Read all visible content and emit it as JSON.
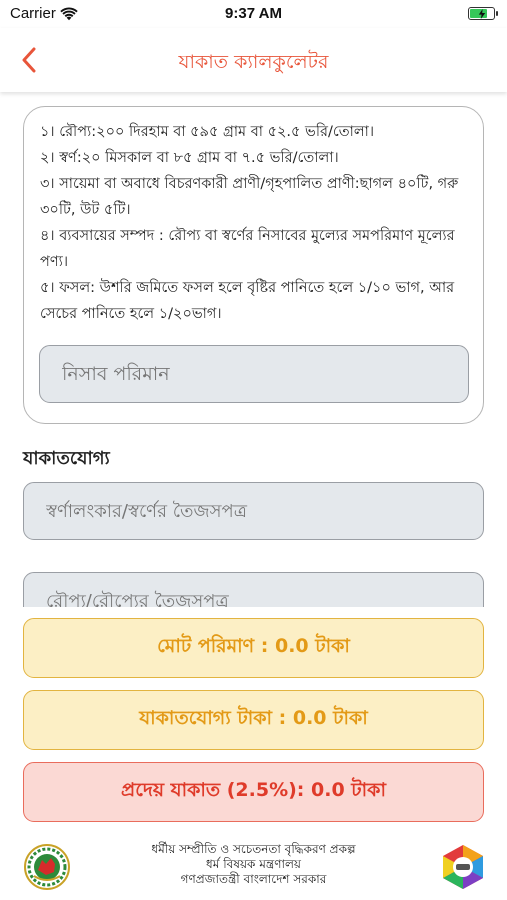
{
  "status_bar": {
    "carrier": "Carrier",
    "time": "9:37 AM",
    "battery_level": 0.75,
    "icons": [
      "wifi-icon",
      "battery-charging-icon"
    ]
  },
  "nav": {
    "title": "যাকাত ক্যালকুলেটর",
    "back_icon": "chevron-left-icon",
    "accent_color": "#e8553a"
  },
  "nisab": {
    "rules": [
      "১। রৌপ্য:২০০ দিরহাম বা ৫৯৫ গ্রাম বা ৫২.৫ ভরি/তোলা।",
      "২। স্বর্ণ:২০ মিসকাল বা ৮৫ গ্রাম বা  ৭.৫ ভরি/তোলা।",
      "৩। সায়েমা বা অবাধে বিচরণকারী প্রাণী/গৃহপালিত প্রাণী:ছাগল ৪০টি, গরু ৩০টি, উট ৫টি।",
      "৪। ব্যবসায়ের সম্পদ : রৌপ্য বা স্বর্ণের নিসাবের মুল্যের সমপরিমাণ মূল্যের পণ্য।",
      "৫। ফসল: উশরি জমিতে ফসল হলে বৃষ্টির পানিতে হলে ১/১০ ভাগ, আর সেচের পানিতে হলে ১/২০ভাগ।"
    ],
    "input_placeholder": "নিসাব পরিমান"
  },
  "zakatable": {
    "section_label": "যাকাতযোগ্য",
    "fields": [
      {
        "placeholder": "স্বর্ণালংকার/স্বর্ণের তৈজসপত্র"
      },
      {
        "placeholder": "রৌপ্য/রৌপ্যের তৈজসপত্র"
      }
    ]
  },
  "results": {
    "total": "মোট পরিমাণ : 0.0 টাকা",
    "zakatable_amount": "যাকাতযোগ্য টাকা : 0.0 টাকা",
    "payable": "প্রদেয় যাকাত (2.5%): 0.0 টাকা",
    "colors": {
      "amber": "#e39a17",
      "red": "#df3b2a"
    }
  },
  "footer": {
    "lines": [
      "ধর্মীয় সম্প্রীতি ও সচেতনতা বৃদ্ধিকরণ প্রকল্প",
      "ধর্ম বিষয়ক মন্ত্রণালয়",
      "গণপ্রজাতন্ত্রী বাংলাদেশ সরকার"
    ],
    "left_logo": "government-seal-icon",
    "right_logo": "project-logo-icon"
  }
}
